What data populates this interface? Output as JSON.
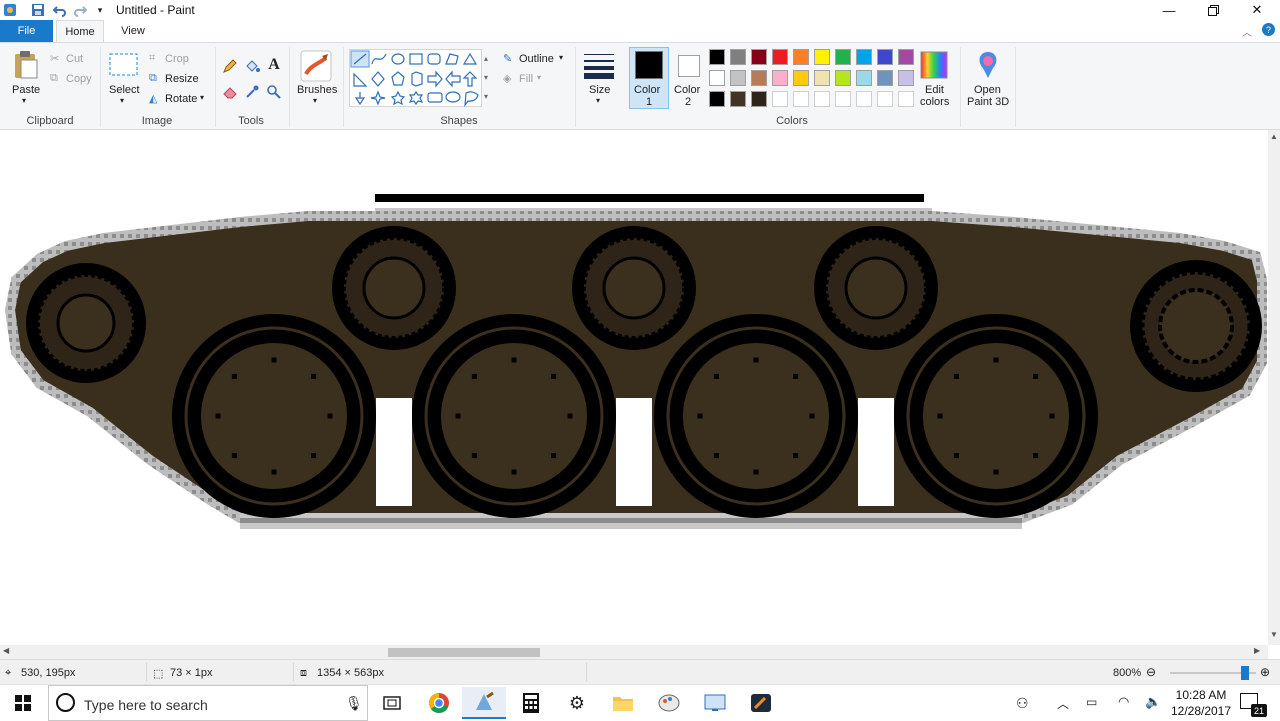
{
  "window": {
    "title": "Untitled - Paint"
  },
  "tabs": {
    "file": "File",
    "home": "Home",
    "view": "View"
  },
  "clipboard": {
    "paste": "Paste",
    "cut": "Cut",
    "copy": "Copy",
    "label": "Clipboard"
  },
  "image": {
    "select": "Select",
    "crop": "Crop",
    "resize": "Resize",
    "rotate": "Rotate",
    "label": "Image"
  },
  "tools": {
    "label": "Tools",
    "text_tool": "A"
  },
  "brushes": {
    "label": "Brushes"
  },
  "shapes": {
    "outline": "Outline",
    "fill": "Fill",
    "label": "Shapes"
  },
  "size": {
    "label": "Size"
  },
  "colors": {
    "color1_label": "Color",
    "color1_num": "1",
    "color2_label": "Color",
    "color2_num": "2",
    "edit": "Edit",
    "edit2": "colors",
    "label": "Colors",
    "color1_value": "#000000",
    "color2_value": "#ffffff",
    "palette_row1": [
      "#000000",
      "#7f7f7f",
      "#880015",
      "#ed1c24",
      "#ff7f27",
      "#fff200",
      "#22b14c",
      "#00a2e8",
      "#3f48cc",
      "#a349a4"
    ],
    "palette_row2": [
      "#ffffff",
      "#c3c3c3",
      "#b97a57",
      "#ffaec9",
      "#ffc90e",
      "#efe4b0",
      "#b5e61d",
      "#99d9ea",
      "#7092be",
      "#c8bfe7"
    ],
    "palette_row3": [
      "#000000",
      "#3f3426",
      "#2e2518",
      "",
      "",
      "",
      "",
      "",
      "",
      ""
    ]
  },
  "paint3d": {
    "line1": "Open",
    "line2": "Paint 3D"
  },
  "status": {
    "cursor_pos": "530, 195px",
    "selection_size": "73 × 1px",
    "image_size": "1354 × 563px",
    "zoom": "800%"
  },
  "taskbar": {
    "search_placeholder": "Type here to search",
    "time": "10:28 AM",
    "date": "12/28/2017",
    "notification_count": "21"
  },
  "drawing": {
    "hull_color": "#3a2e1d",
    "wheel_color": "#3b2f1e",
    "track_light": "#c8c8c8",
    "track_dark": "#8c8c8c"
  }
}
